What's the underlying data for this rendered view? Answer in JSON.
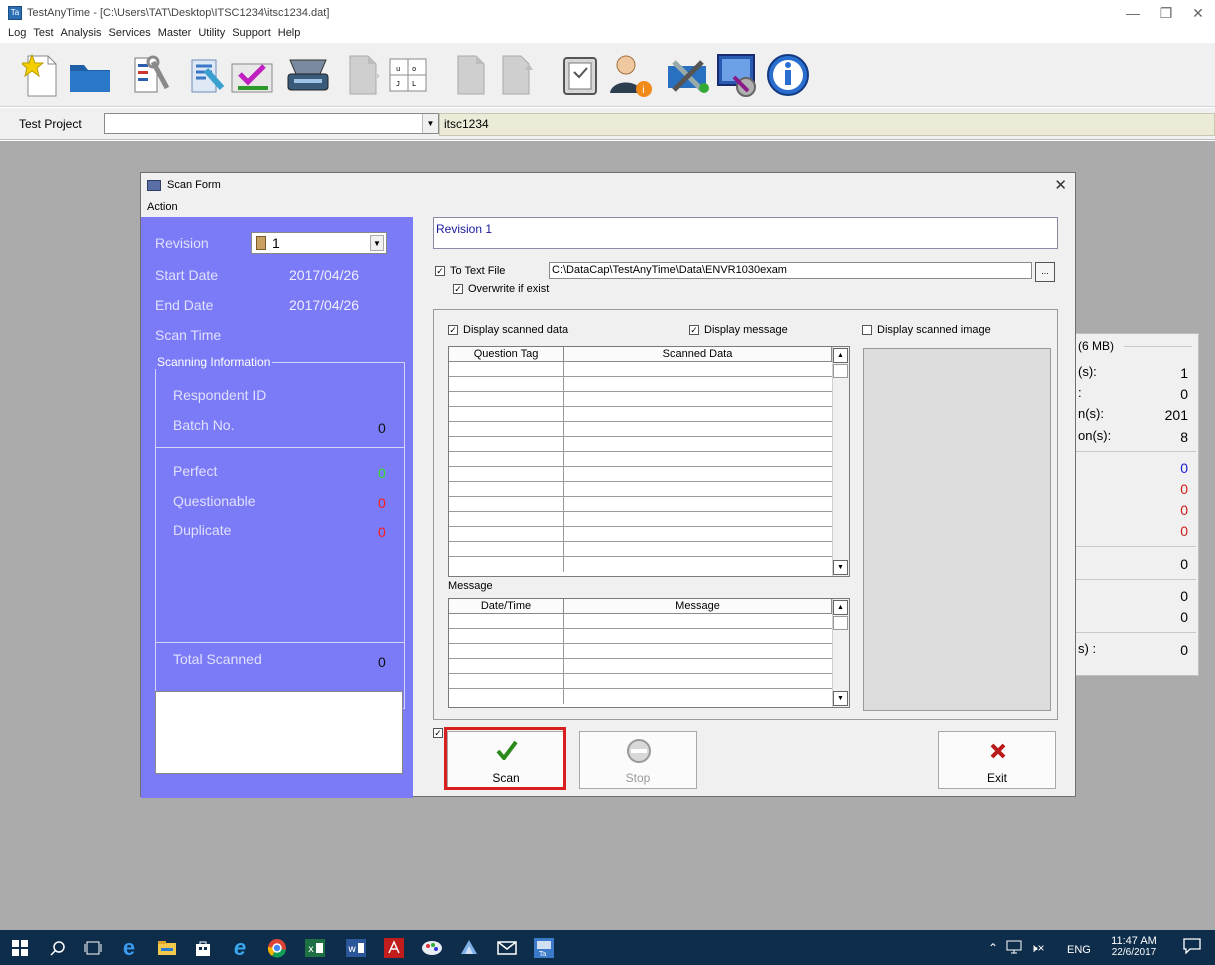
{
  "window": {
    "title": "TestAnyTime - [C:\\Users\\TAT\\Desktop\\ITSC1234\\itsc1234.dat]",
    "menu": [
      "Log",
      "Test",
      "Analysis",
      "Services",
      "Master",
      "Utility",
      "Support",
      "Help"
    ]
  },
  "toolbar": {
    "icons": [
      "new-file-icon",
      "open-folder-icon",
      "tools-icon",
      "designer-icon",
      "edit-form-icon",
      "scanner-icon",
      "document-icon",
      "answer-key-icon",
      "blank-page-icon",
      "export-icon",
      "safe-icon",
      "user-info-icon",
      "tools-settings-icon",
      "monitor-settings-icon",
      "info-icon"
    ]
  },
  "project_bar": {
    "label": "Test Project",
    "value": "",
    "project_name": "itsc1234"
  },
  "background_panel": {
    "rows_top": [
      {
        "text": "(s):",
        "value": "1"
      },
      {
        "text": ":",
        "value": "0"
      },
      {
        "text": "n(s):",
        "value": "201"
      },
      {
        "text": "on(s):",
        "value": "8"
      }
    ],
    "title_fragment": "(6 MB)",
    "rows_mid": [
      {
        "value": "0",
        "color": "#1a1ad0"
      },
      {
        "value": "0",
        "color": "#d01a1a"
      },
      {
        "value": "0",
        "color": "#d01a1a"
      },
      {
        "value": "0",
        "color": "#d01a1a"
      }
    ],
    "rows_low": [
      "0",
      "0",
      "0"
    ],
    "last_text": "s) :",
    "last_value": "0"
  },
  "scan_form": {
    "title": "Scan Form",
    "menu_action": "Action",
    "left": {
      "revision_label": "Revision",
      "revision_value": "1",
      "start_date_label": "Start Date",
      "start_date": "2017/04/26",
      "end_date_label": "End Date",
      "end_date": "2017/04/26",
      "scan_time_label": "Scan Time",
      "group_title": "Scanning Information",
      "respondent_label": "Respondent ID",
      "batch_label": "Batch No.",
      "batch_value": "0",
      "perfect_label": "Perfect",
      "perfect_value": "0",
      "questionable_label": "Questionable",
      "questionable_value": "0",
      "duplicate_label": "Duplicate",
      "duplicate_value": "0",
      "total_label": "Total Scanned",
      "total_value": "0",
      "colors": {
        "perfect": "#30e030",
        "questionable": "#ff1a1a",
        "duplicate": "#ff1a1a"
      }
    },
    "right": {
      "revision_title": "Revision 1",
      "to_text_file_label": "To Text File",
      "overwrite_label": "Overwrite if exist",
      "file_path": "C:\\DataCap\\TestAnyTime\\Data\\ENVR1030exam",
      "display_scanned_data_label": "Display scanned data",
      "display_message_label": "Display message",
      "display_scanned_image_label": "Display scanned image",
      "grid1_cols": [
        "Question Tag",
        "Scanned Data"
      ],
      "message_label": "Message",
      "grid2_cols": [
        "Date/Time",
        "Message"
      ]
    },
    "buttons": {
      "scan": "Scan",
      "stop": "Stop",
      "exit": "Exit"
    }
  },
  "taskbar": {
    "icons": [
      "windows-start-icon",
      "search-icon",
      "task-view-icon",
      "edge-icon",
      "file-explorer-icon",
      "store-icon",
      "internet-explorer-icon",
      "chrome-icon",
      "excel-icon",
      "word-icon",
      "acrobat-icon",
      "paint-icon",
      "notes-icon",
      "mail-icon",
      "testanytime-icon"
    ],
    "lang": "ENG",
    "time": "11:47 AM",
    "date": "22/6/2017"
  }
}
